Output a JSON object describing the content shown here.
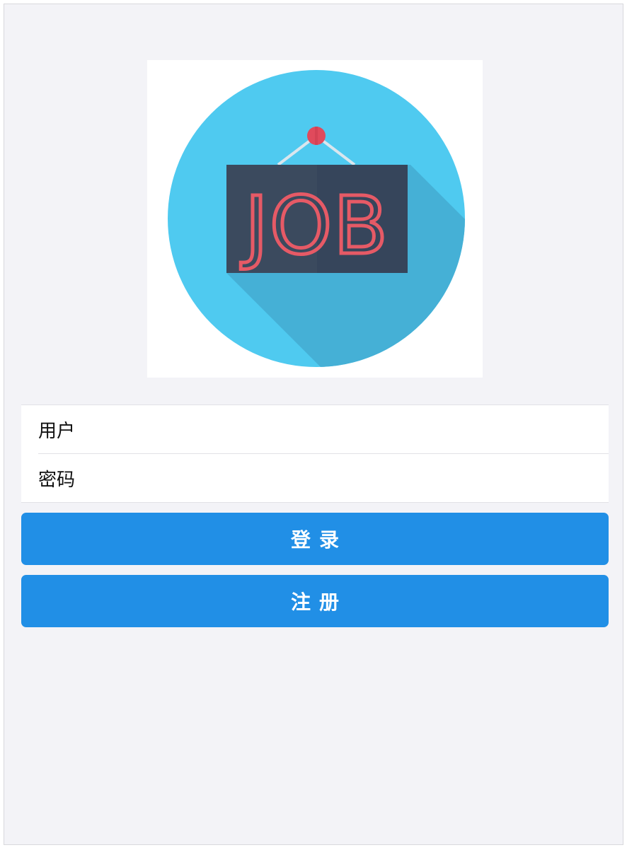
{
  "logo": {
    "text": "JOB",
    "colors": {
      "circle": "#4fcaf0",
      "shadow": "#45b0d6",
      "sign": "#3b4a5e",
      "letters": "#e65a66",
      "pin": "#e04a5c"
    }
  },
  "form": {
    "username_label": "用户",
    "username_value": "",
    "password_label": "密码",
    "password_value": ""
  },
  "buttons": {
    "login_label": "登录",
    "register_label": "注册",
    "color": "#218fe6"
  }
}
